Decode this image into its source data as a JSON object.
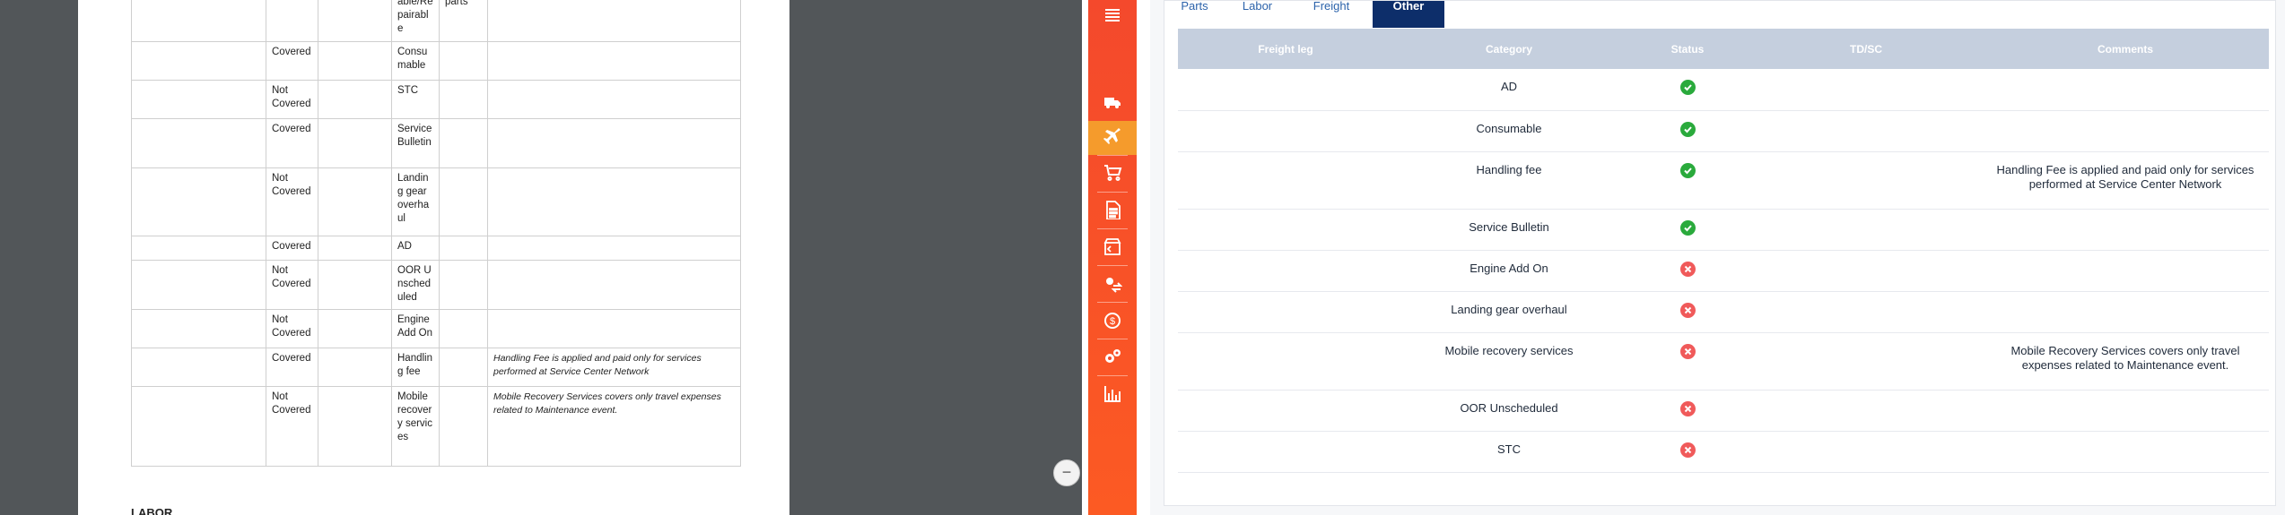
{
  "document": {
    "rows": [
      {
        "coverage": "",
        "category": "able/Re pairable",
        "extra": "parts",
        "comment": ""
      },
      {
        "coverage": "Covered",
        "category": "Consumable",
        "extra": "",
        "comment": ""
      },
      {
        "coverage": "Not Covered",
        "category": "STC",
        "extra": "",
        "comment": ""
      },
      {
        "coverage": "Covered",
        "category": "Service Bulletin",
        "extra": "",
        "comment": ""
      },
      {
        "coverage": "Not Covered",
        "category": "Landing gear overhaul",
        "extra": "",
        "comment": ""
      },
      {
        "coverage": "Covered",
        "category": "AD",
        "extra": "",
        "comment": ""
      },
      {
        "coverage": "Not Covered",
        "category": "OOR Unscheduled",
        "extra": "",
        "comment": ""
      },
      {
        "coverage": "Not Covered",
        "category": "Engine Add On",
        "extra": "",
        "comment": ""
      },
      {
        "coverage": "Covered",
        "category": "Handling fee",
        "extra": "",
        "comment": "Handling Fee is applied and paid only for services performed at Service Center Network"
      },
      {
        "coverage": "Not Covered",
        "category": "Mobile recovery services",
        "extra": "",
        "comment": "Mobile Recovery Services covers only travel expenses related to Maintenance event."
      }
    ],
    "next_heading": "LABOR"
  },
  "sidebar": {
    "items": [
      {
        "icon": "list-icon"
      },
      {
        "icon": "truck-icon"
      },
      {
        "icon": "airplane-icon",
        "active": true
      },
      {
        "icon": "cart-icon"
      },
      {
        "icon": "document-icon"
      },
      {
        "icon": "box-icon"
      },
      {
        "icon": "gear-arrows-icon"
      },
      {
        "icon": "dollar-cycle-icon"
      },
      {
        "icon": "gears-icon"
      },
      {
        "icon": "bar-chart-icon"
      }
    ]
  },
  "collapse_button": {
    "label": "−"
  },
  "tabs": [
    {
      "label": "Parts",
      "active": false
    },
    {
      "label": "Labor",
      "active": false
    },
    {
      "label": "Freight",
      "active": false
    },
    {
      "label": "Other",
      "active": true
    }
  ],
  "grid": {
    "headers": [
      "Freight leg",
      "Category",
      "Status",
      "TD/SC",
      "Comments"
    ],
    "rows": [
      {
        "freight_leg": "",
        "category": "AD",
        "status": "covered",
        "td_sc": "",
        "comments": ""
      },
      {
        "freight_leg": "",
        "category": "Consumable",
        "status": "covered",
        "td_sc": "",
        "comments": ""
      },
      {
        "freight_leg": "",
        "category": "Handling fee",
        "status": "covered",
        "td_sc": "",
        "comments": "Handling Fee is applied and paid only for services performed at Service Center Network"
      },
      {
        "freight_leg": "",
        "category": "Service Bulletin",
        "status": "covered",
        "td_sc": "",
        "comments": ""
      },
      {
        "freight_leg": "",
        "category": "Engine Add On",
        "status": "not-covered",
        "td_sc": "",
        "comments": ""
      },
      {
        "freight_leg": "",
        "category": "Landing gear overhaul",
        "status": "not-covered",
        "td_sc": "",
        "comments": ""
      },
      {
        "freight_leg": "",
        "category": "Mobile recovery services",
        "status": "not-covered",
        "td_sc": "",
        "comments": "Mobile Recovery Services covers only travel expenses related to Maintenance event."
      },
      {
        "freight_leg": "",
        "category": "OOR Unscheduled",
        "status": "not-covered",
        "td_sc": "",
        "comments": ""
      },
      {
        "freight_leg": "",
        "category": "STC",
        "status": "not-covered",
        "td_sc": "",
        "comments": ""
      }
    ]
  },
  "colors": {
    "sidebar": "#f4492c",
    "sidebar_active": "#f59b2c",
    "tab_active": "#0d2e6a",
    "header_bg": "#c5cfde",
    "covered": "#2aaa3c",
    "not_covered": "#f05a5a"
  }
}
